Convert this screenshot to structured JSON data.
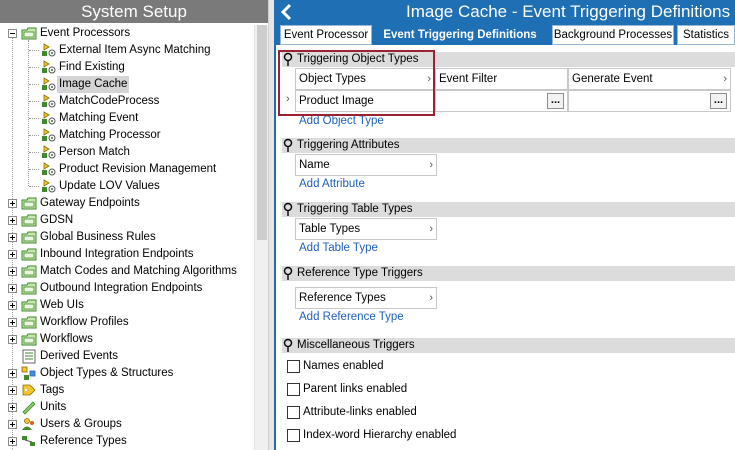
{
  "left_pane": {
    "title": "System Setup",
    "tree": [
      {
        "label": "Event Processors",
        "depth": 0,
        "kind": "folder",
        "state": "expanded"
      },
      {
        "label": "External Item Async Matching",
        "depth": 1,
        "kind": "processor"
      },
      {
        "label": "Find Existing",
        "depth": 1,
        "kind": "processor"
      },
      {
        "label": "Image Cache",
        "depth": 1,
        "kind": "processor",
        "selected": true
      },
      {
        "label": "MatchCodeProcess",
        "depth": 1,
        "kind": "processor"
      },
      {
        "label": "Matching Event",
        "depth": 1,
        "kind": "processor"
      },
      {
        "label": "Matching Processor",
        "depth": 1,
        "kind": "processor"
      },
      {
        "label": "Person Match",
        "depth": 1,
        "kind": "processor"
      },
      {
        "label": "Product Revision Management",
        "depth": 1,
        "kind": "processor"
      },
      {
        "label": "Update LOV Values",
        "depth": 1,
        "kind": "processor"
      },
      {
        "label": "Gateway Endpoints",
        "depth": 0,
        "kind": "folder",
        "state": "collapsed"
      },
      {
        "label": "GDSN",
        "depth": 0,
        "kind": "folder",
        "state": "collapsed"
      },
      {
        "label": "Global Business Rules",
        "depth": 0,
        "kind": "folder",
        "state": "collapsed"
      },
      {
        "label": "Inbound Integration Endpoints",
        "depth": 0,
        "kind": "folder",
        "state": "collapsed"
      },
      {
        "label": "Match Codes and Matching Algorithms",
        "depth": 0,
        "kind": "folder",
        "state": "collapsed"
      },
      {
        "label": "Outbound Integration Endpoints",
        "depth": 0,
        "kind": "folder",
        "state": "collapsed"
      },
      {
        "label": "Web UIs",
        "depth": 0,
        "kind": "folder",
        "state": "collapsed"
      },
      {
        "label": "Workflow Profiles",
        "depth": 0,
        "kind": "folder",
        "state": "collapsed"
      },
      {
        "label": "Workflows",
        "depth": 0,
        "kind": "folder",
        "state": "collapsed"
      },
      {
        "label": "Derived Events",
        "depth": 0,
        "kind": "list",
        "state": "none"
      },
      {
        "label": "Object Types & Structures",
        "depth": 0,
        "kind": "objtypes",
        "state": "collapsed"
      },
      {
        "label": "Tags",
        "depth": 0,
        "kind": "tag",
        "state": "collapsed"
      },
      {
        "label": "Units",
        "depth": 0,
        "kind": "ruler",
        "state": "collapsed"
      },
      {
        "label": "Users & Groups",
        "depth": 0,
        "kind": "users",
        "state": "collapsed"
      },
      {
        "label": "Reference Types",
        "depth": 0,
        "kind": "reftypes",
        "state": "collapsed"
      }
    ]
  },
  "right_pane": {
    "title": "Image Cache - Event Triggering Definitions",
    "tabs": [
      {
        "label": "Event Processor",
        "active": false
      },
      {
        "label": "Event Triggering Definitions",
        "active": true
      },
      {
        "label": "Background Processes",
        "active": false
      },
      {
        "label": "Statistics",
        "active": false
      }
    ],
    "sections": {
      "object_types": {
        "title": "Triggering Object Types",
        "columns": [
          "Object Types",
          "Event Filter",
          "Generate Event"
        ],
        "rows": [
          {
            "object_type": "Product Image",
            "event_filter": "",
            "generate_event": ""
          }
        ],
        "add_link": "Add Object Type"
      },
      "attributes": {
        "title": "Triggering Attributes",
        "column": "Name",
        "add_link": "Add Attribute"
      },
      "table_types": {
        "title": "Triggering Table Types",
        "column": "Table Types",
        "add_link": "Add Table Type"
      },
      "reference_triggers": {
        "title": "Reference Type Triggers",
        "column": "Reference Types",
        "add_link": "Add Reference Type"
      },
      "misc": {
        "title": "Miscellaneous Triggers",
        "checkboxes": [
          {
            "label": "Names enabled",
            "checked": false
          },
          {
            "label": "Parent links enabled",
            "checked": false
          },
          {
            "label": "Attribute-links enabled",
            "checked": false
          },
          {
            "label": "Index-word Hierarchy enabled",
            "checked": false
          }
        ]
      }
    },
    "ellipsis_label": "...",
    "chevron": "›"
  },
  "colors": {
    "header_blue": "#1f6fb5",
    "left_header_gray": "#7a7a7a",
    "section_gray": "#dcdcdc",
    "link_blue": "#1f5fbf",
    "highlight_red": "#9b2232",
    "selected_gray": "#d4d4d4"
  }
}
